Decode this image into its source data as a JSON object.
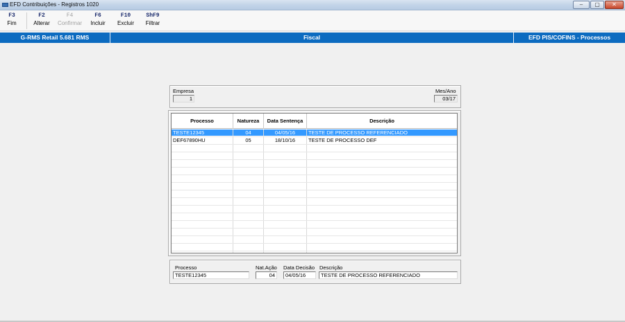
{
  "window": {
    "title": "EFD Contribuições - Registros 1020",
    "minimize": "–",
    "restore": "▢",
    "close": "✕"
  },
  "toolbar": [
    {
      "key": "F3",
      "label": "Fim",
      "enabled": true
    },
    {
      "key": "F2",
      "label": "Alterar",
      "enabled": true
    },
    {
      "key": "F4",
      "label": "Confirmar",
      "enabled": false
    },
    {
      "key": "F6",
      "label": "Incluir",
      "enabled": true
    },
    {
      "key": "F10",
      "label": "Excluir",
      "enabled": true
    },
    {
      "key": "ShF9",
      "label": "Filtrar",
      "enabled": true
    }
  ],
  "band": {
    "left": "G-RMS Retail 5.681 RMS",
    "center": "Fiscal",
    "right": "EFD PIS/COFINS - Processos"
  },
  "header_panel": {
    "empresa_label": "Empresa",
    "empresa_value": "1",
    "mesano_label": "Mes/Ano",
    "mesano_value": "03/17"
  },
  "grid": {
    "columns": [
      "Processo",
      "Natureza",
      "Data Sentença",
      "Descrição"
    ],
    "rows": [
      {
        "processo": "TESTE12345",
        "natureza": "04",
        "data": "04/05/16",
        "descricao": "TESTE DE PROCESSO REFERENCIADO",
        "selected": true
      },
      {
        "processo": "DEF67890HU",
        "natureza": "05",
        "data": "18/10/16",
        "descricao": "TESTE DE PROCESSO DEF",
        "selected": false
      }
    ]
  },
  "detail_panel": {
    "processo_label": "Processo",
    "processo_value": "TESTE12345",
    "natacao_label": "Nat.Ação",
    "natacao_value": "04",
    "datadecisao_label": "Data Decisão",
    "datadecisao_value": "04/05/16",
    "descricao_label": "Descrição",
    "descricao_value": "TESTE DE PROCESSO REFERENCIADO"
  },
  "colors": {
    "band": "#0c6bc0",
    "selection": "#3399ff",
    "shortcut_key": "#1a2a6c"
  },
  "icons": [
    "app-icon",
    "minimize-icon",
    "restore-icon",
    "close-icon"
  ]
}
